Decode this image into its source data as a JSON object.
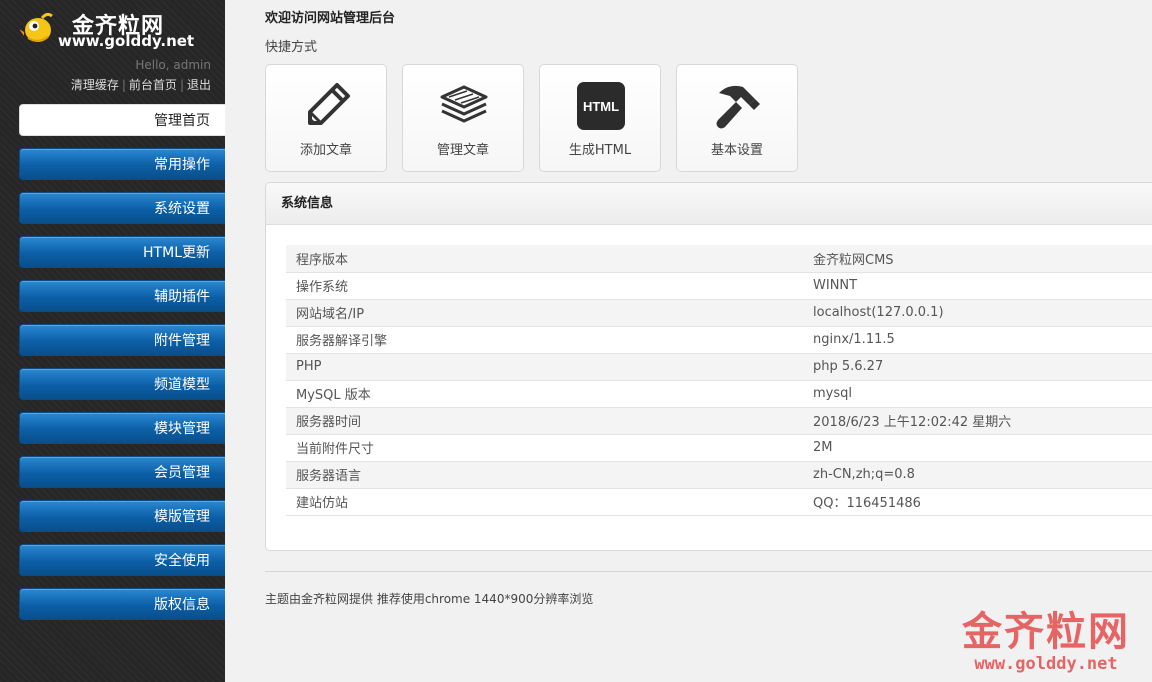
{
  "brand": {
    "name": "金齐粒网",
    "url": "www.golddy.net",
    "hello": "Hello, admin",
    "links": [
      "清理缓存",
      "前台首页",
      "退出"
    ]
  },
  "nav": {
    "items": [
      "管理首页",
      "常用操作",
      "系统设置",
      "HTML更新",
      "辅助插件",
      "附件管理",
      "频道模型",
      "模块管理",
      "会员管理",
      "模版管理",
      "安全使用",
      "版权信息"
    ],
    "active_index": 0,
    "accent": "#0c5fa6"
  },
  "main": {
    "welcome": "欢迎访问网站管理后台",
    "shortcut_title": "快捷方式",
    "shortcuts": [
      {
        "label": "添加文章",
        "icon": "pencil-icon"
      },
      {
        "label": "管理文章",
        "icon": "stack-icon"
      },
      {
        "label": "生成HTML",
        "icon": "html-icon",
        "icon_text": "HTML"
      },
      {
        "label": "基本设置",
        "icon": "hammer-icon"
      }
    ]
  },
  "sysinfo": {
    "title": "系统信息",
    "rows": [
      {
        "key": "程序版本",
        "value": "金齐粒网CMS"
      },
      {
        "key": "操作系统",
        "value": "WINNT"
      },
      {
        "key": "网站域名/IP",
        "value": "localhost(127.0.0.1)"
      },
      {
        "key": "服务器解译引擎",
        "value": "nginx/1.11.5"
      },
      {
        "key": "PHP",
        "value": "php 5.6.27"
      },
      {
        "key": "MySQL 版本",
        "value": "mysql"
      },
      {
        "key": "服务器时间",
        "value": "2018/6/23 上午12:02:42 星期六"
      },
      {
        "key": "当前附件尺寸",
        "value": "2M"
      },
      {
        "key": "服务器语言",
        "value": "zh-CN,zh;q=0.8"
      },
      {
        "key": "建站仿站",
        "value": "QQ：116451486"
      }
    ]
  },
  "footer": {
    "text": "主题由金齐粒网提供 推荐使用chrome 1440*900分辨率浏览"
  },
  "watermark": {
    "name": "金齐粒网",
    "url": "www.golddy.net",
    "color": "#e23434"
  }
}
